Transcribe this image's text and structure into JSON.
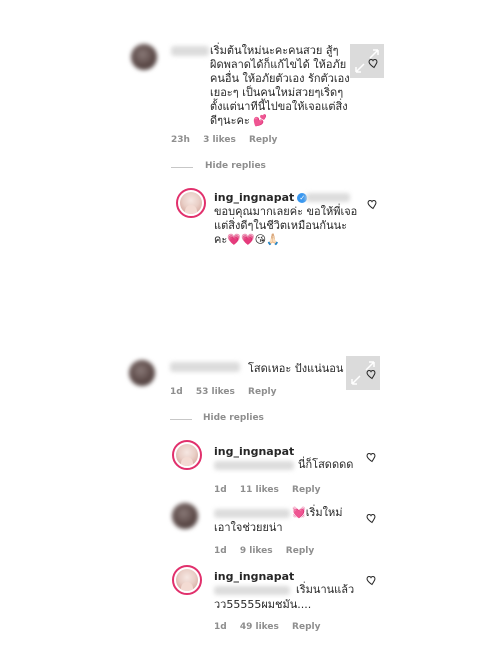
{
  "comments": [
    {
      "text": "เริ่มต้นใหม่นะคะคนสวย สู้ๆ ผิดพลาดได้ก็แก้ไขได้ ให้อภัยคนอื่น ให้อภัยตัวเอง รักตัวเองเยอะๆ เป็นคนใหม่สวยๆเริ่ดๆ ตั้งแต่นาทีนี้ไปขอให้เจอแต่สิ่งดีๆนะคะ",
      "emoji": "💕",
      "time": "23h",
      "likes": "3 likes",
      "reply": "Reply"
    },
    {
      "text": "โสดเหอะ ปังแน่นอน",
      "time": "1d",
      "likes": "53 likes",
      "reply": "Reply"
    }
  ],
  "hide_replies": "Hide replies",
  "replies": [
    {
      "username": "ing_ingnapat",
      "text": "ขอบคุณมากเลยค่ะ ขอให้พี่เจอแต่สิ่งดีๆในชีวิตเหมือนกันนะคะ",
      "emoji": "💗💗😘🙏🏻"
    },
    {
      "username": "ing_ingnapat",
      "text": "นี่ก็โสดดดด",
      "time": "1d",
      "likes": "11 likes",
      "reply": "Reply"
    },
    {
      "emoji": "💓",
      "text_line1": "เริ่มใหม่",
      "text_line2": "เอาใจช่วยยน่า",
      "time": "1d",
      "likes": "9 likes",
      "reply": "Reply"
    },
    {
      "username": "ing_ingnapat",
      "text_line1": "เริ่มนานแล้ว",
      "text_line2": "วว55555ผมชมัน....",
      "time": "1d",
      "likes": "49 likes",
      "reply": "Reply"
    }
  ],
  "icons": {
    "like": "heart-outline-icon",
    "expand": "expand-arrows-icon",
    "verified": "verified-badge-icon"
  }
}
